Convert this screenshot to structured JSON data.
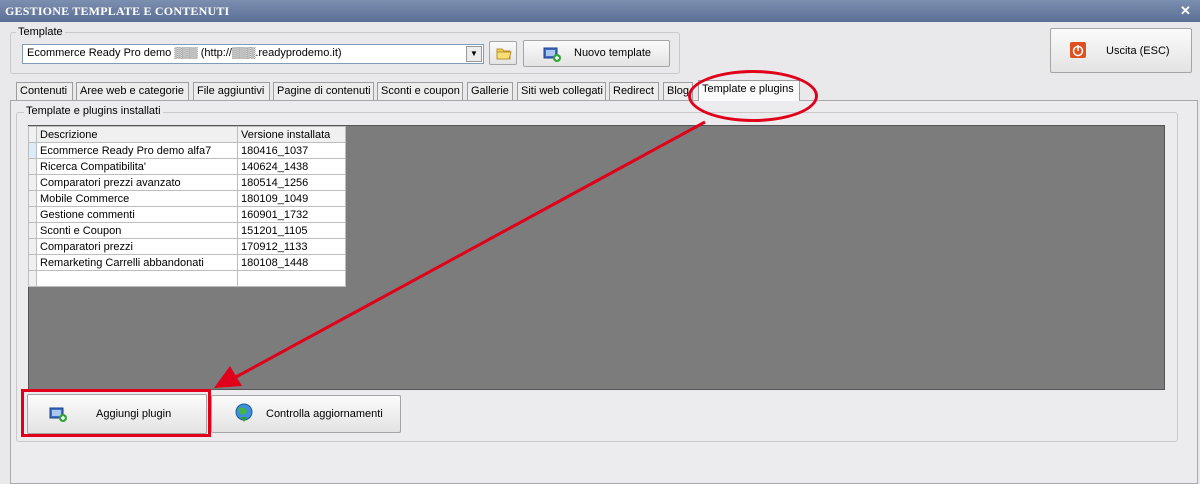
{
  "window": {
    "title": "GESTIONE TEMPLATE E CONTENUTI",
    "close_glyph": "✕"
  },
  "template_group": {
    "label": "Template",
    "selected_template": "Ecommerce Ready Pro demo ▒▒▒ (http://▒▒▒.readyprodemo.it)",
    "new_template_button": "Nuovo template"
  },
  "exit_button": "Uscita (ESC)",
  "tabs": [
    {
      "label": "Contenuti"
    },
    {
      "label": "Aree web e categorie"
    },
    {
      "label": "File aggiuntivi"
    },
    {
      "label": "Pagine di contenuti"
    },
    {
      "label": "Sconti e coupon"
    },
    {
      "label": "Gallerie"
    },
    {
      "label": "Siti web collegati"
    },
    {
      "label": "Redirect"
    },
    {
      "label": "Blog"
    },
    {
      "label": "Template e plugins"
    }
  ],
  "active_tab": "Template e plugins",
  "installed_group": {
    "label": "Template e plugins installati",
    "columns": [
      "Descrizione",
      "Versione installata"
    ],
    "rows": [
      [
        "Ecommerce Ready Pro demo alfa7",
        "180416_1037"
      ],
      [
        "Ricerca Compatibilita'",
        "140624_1438"
      ],
      [
        "Comparatori prezzi avanzato",
        "180514_1256"
      ],
      [
        "Mobile Commerce",
        "180109_1049"
      ],
      [
        "Gestione commenti",
        "160901_1732"
      ],
      [
        "Sconti e Coupon",
        "151201_1105"
      ],
      [
        "Comparatori prezzi",
        "170912_1133"
      ],
      [
        "Remarketing Carrelli abbandonati",
        "180108_1448"
      ]
    ]
  },
  "buttons": {
    "add_plugin": "Aggiungi plugin",
    "check_updates": "Controlla aggiornamenti"
  },
  "colors": {
    "annotation_red": "#e0001a",
    "titlebar": "#6a7fa5",
    "grid_bg": "#7c7c7c"
  }
}
